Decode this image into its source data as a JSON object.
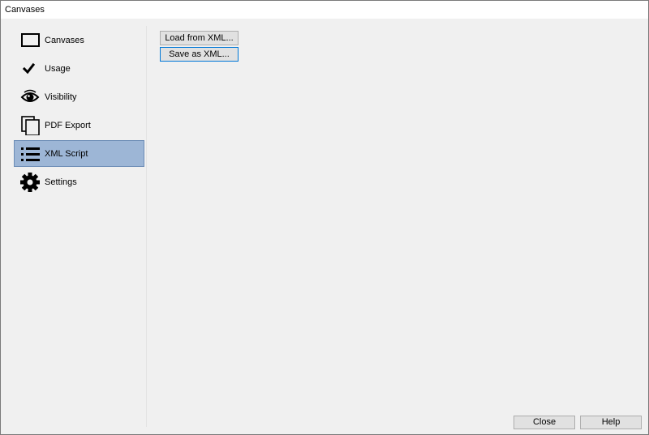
{
  "window": {
    "title": "Canvases"
  },
  "sidebar": {
    "items": [
      {
        "label": "Canvases",
        "icon": "rectangle-icon",
        "selected": false
      },
      {
        "label": "Usage",
        "icon": "checkmark-icon",
        "selected": false
      },
      {
        "label": "Visibility",
        "icon": "eye-icon",
        "selected": false
      },
      {
        "label": "PDF Export",
        "icon": "pages-icon",
        "selected": false
      },
      {
        "label": "XML Script",
        "icon": "list-icon",
        "selected": true
      },
      {
        "label": "Settings",
        "icon": "gear-icon",
        "selected": false
      }
    ]
  },
  "content": {
    "load_label": "Load from XML...",
    "save_label": "Save as XML..."
  },
  "footer": {
    "close_label": "Close",
    "help_label": "Help"
  },
  "colors": {
    "selected_bg": "#9db6d6",
    "selected_border": "#6c8cb6",
    "focus_border": "#0078d7",
    "window_bg": "#f0f0f0"
  }
}
